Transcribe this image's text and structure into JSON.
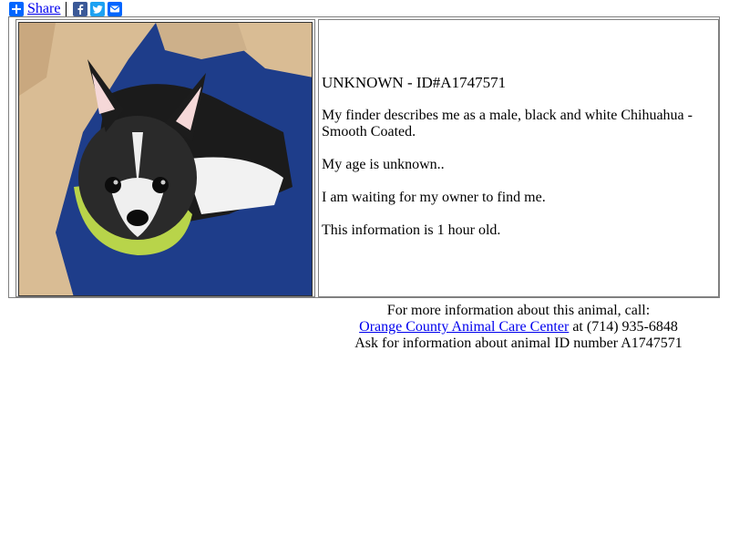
{
  "share": {
    "label": "Share",
    "icons": [
      "plus-icon",
      "facebook-icon",
      "twitter-icon",
      "email-icon"
    ],
    "colors": {
      "plus": "#0166ff",
      "facebook": "#3b5998",
      "twitter": "#1da1f2",
      "email": "#0166ff"
    }
  },
  "animal": {
    "title": "UNKNOWN - ID#A1747571",
    "description": "My finder describes me as a male, black and white Chihuahua - Smooth Coated.",
    "age": "My age is unknown..",
    "status": "I am waiting for my owner to find me.",
    "freshness": "This information is 1 hour old."
  },
  "contact": {
    "intro": "For more information about this animal, call:",
    "center_link": "Orange County Animal Care Center",
    "phone": " at (714) 935-6848",
    "ask": "Ask for information about animal ID number A1747571"
  },
  "colors": {
    "link": "#0000ee",
    "border": "#808080"
  }
}
